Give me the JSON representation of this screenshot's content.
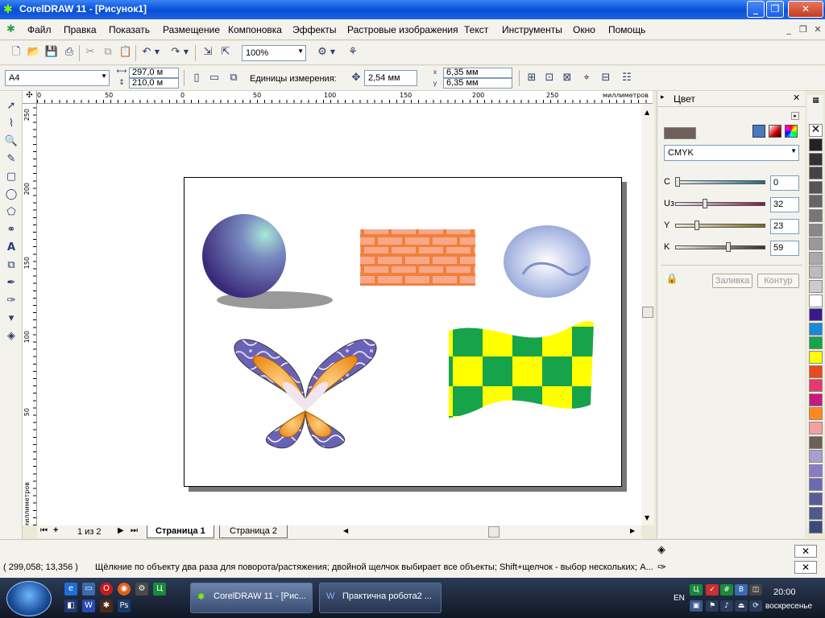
{
  "window": {
    "title": "CorelDRAW 11 - [Рисунок1]",
    "minimize": "_",
    "maximize": "❐",
    "close": "✕"
  },
  "menu": {
    "items": [
      "Файл",
      "Правка",
      "Показать",
      "Размещение",
      "Компоновка",
      "Эффекты",
      "Растровые изображения",
      "Текст",
      "Инструменты",
      "Окно",
      "Помощь"
    ],
    "doc_minimize": "_",
    "doc_restore": "❐",
    "doc_close": "✕"
  },
  "standard_toolbar": {
    "zoom": "100%"
  },
  "property_bar": {
    "paper_size": "A4",
    "width": "297,0 м",
    "height": "210,0 м",
    "units_label": "Единицы измерения:",
    "nudge": "2,54 мм",
    "dup_x": "6,35 мм",
    "dup_y": "6,35 мм"
  },
  "rulers": {
    "top_labels": [
      "50",
      "0",
      "50",
      "100",
      "150",
      "200",
      "250"
    ],
    "top_unit": "миллиметров",
    "left_labels": [
      "250",
      "200",
      "150",
      "100",
      "50"
    ],
    "left_unit": "миллиметров"
  },
  "page_tabs": {
    "counter": "1 из 2",
    "tabs": [
      "Страница 1",
      "Страница 2"
    ]
  },
  "docker": {
    "title": "Цвет",
    "current_color": "#6e5f5a",
    "model": "CMYK",
    "channels": [
      {
        "label": "C",
        "value": "0",
        "level": 0.0,
        "gradient": "#e8f0f2,#1a6e80"
      },
      {
        "label": "Uз",
        "value": "32",
        "level": 0.32,
        "gradient": "#e8e0e8,#7a1c4c"
      },
      {
        "label": "Y",
        "value": "23",
        "level": 0.23,
        "gradient": "#eee8d8,#7a6a1c"
      },
      {
        "label": "K",
        "value": "59",
        "level": 0.59,
        "gradient": "#f2e4e4,#3a3030"
      }
    ],
    "fill_button": "Заливка",
    "outline_button": "Контур"
  },
  "palette": {
    "colors": [
      "#222222",
      "#333333",
      "#444444",
      "#555555",
      "#666666",
      "#777777",
      "#888888",
      "#999999",
      "#aaaaaa",
      "#bbbbbb",
      "#cccccc",
      "#ffffff",
      "#3a1a8a",
      "#1a8ad6",
      "#17a34a",
      "#ffff00",
      "#e84a1a",
      "#e83a6a",
      "#c81a7a",
      "#ff8a1a",
      "#f4a0a0",
      "#6e5f5a",
      "#a8a0d0",
      "#8a7ac8",
      "#6a6ab0",
      "#5a5a9a",
      "#4a5a8a",
      "#3a4a7a"
    ]
  },
  "status": {
    "coords": "( 299,058; 13,356 )",
    "hint": "Щёлкние по объекту два раза для поворота/растяжения; двойной щелчок выбирает все объекты; Shift+щелчок - выбор нескольких; А..."
  },
  "taskbar": {
    "buttons": [
      "CorelDRAW 11 - [Рис...",
      "Практична робота2 ..."
    ],
    "lang": "EN",
    "time": "20:00",
    "day": "воскресенье"
  }
}
